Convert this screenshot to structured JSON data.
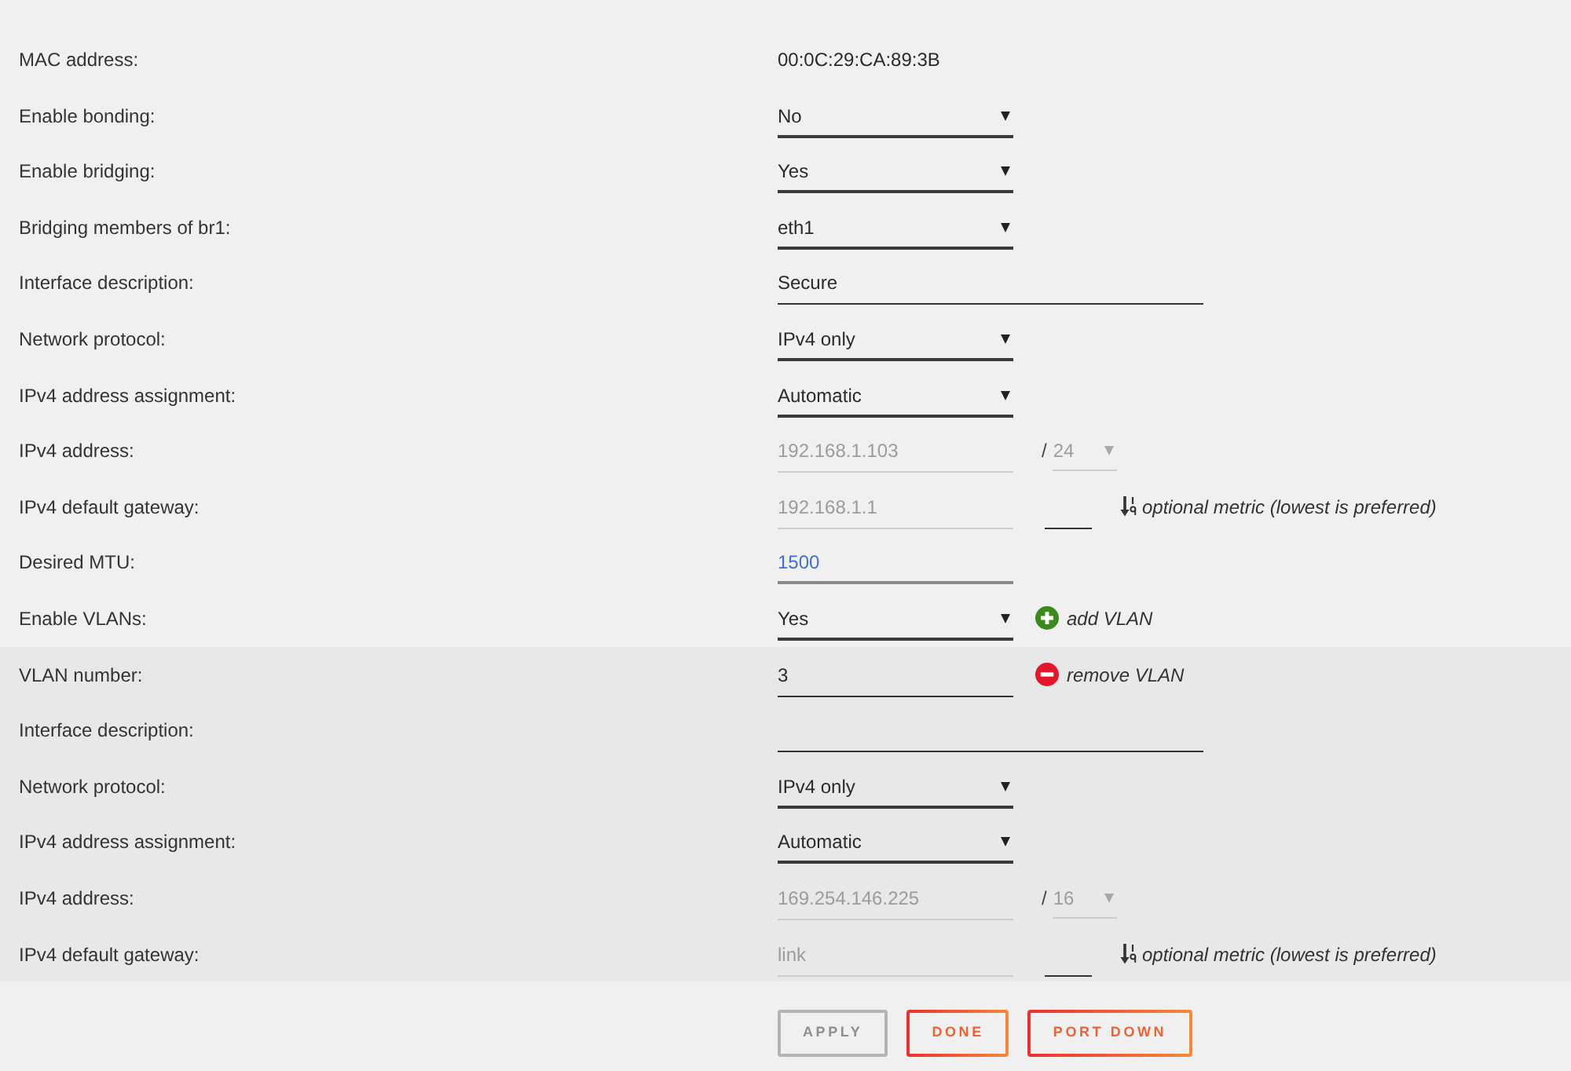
{
  "sections": [
    {
      "kind": "main",
      "rows": [
        {
          "kind": "static",
          "label": "MAC address:",
          "value": "00:0C:29:CA:89:3B",
          "disabled": false,
          "highlighted": false
        },
        {
          "kind": "select",
          "label": "Enable bonding:",
          "value": "No",
          "disabled": false,
          "highlighted": false
        },
        {
          "kind": "select",
          "label": "Enable bridging:",
          "value": "Yes",
          "disabled": false,
          "highlighted": false
        },
        {
          "kind": "select",
          "label": "Bridging members of br1:",
          "value": "eth1",
          "disabled": false,
          "highlighted": false
        },
        {
          "kind": "text",
          "label": "Interface description:",
          "value": "Secure",
          "disabled": false,
          "highlighted": false
        },
        {
          "kind": "select",
          "label": "Network protocol:",
          "value": "IPv4 only",
          "disabled": false,
          "highlighted": false
        },
        {
          "kind": "select",
          "label": "IPv4 address assignment:",
          "value": "Automatic",
          "disabled": false,
          "highlighted": false
        },
        {
          "kind": "address",
          "label": "IPv4 address:",
          "value": "192.168.1.103",
          "disabled": true,
          "highlighted": false,
          "separator": "/",
          "prefix": {
            "value": "24",
            "disabled": true
          }
        },
        {
          "kind": "gateway",
          "label": "IPv4 default gateway:",
          "value": "192.168.1.1",
          "disabled": true,
          "highlighted": false,
          "metric_hint": "optional metric (lowest is preferred)"
        },
        {
          "kind": "input",
          "label": "Desired MTU:",
          "value": "1500",
          "disabled": false,
          "highlighted": true
        },
        {
          "kind": "select",
          "label": "Enable VLANs:",
          "value": "Yes",
          "disabled": false,
          "highlighted": false,
          "action": {
            "kind": "add",
            "label": "add VLAN"
          }
        }
      ]
    },
    {
      "kind": "vlan",
      "rows": [
        {
          "kind": "input",
          "label": "VLAN number:",
          "value": "3",
          "disabled": false,
          "highlighted": false,
          "action": {
            "kind": "remove",
            "label": "remove VLAN"
          }
        },
        {
          "kind": "text",
          "label": "Interface description:",
          "disabled": false,
          "highlighted": false
        },
        {
          "kind": "select",
          "label": "Network protocol:",
          "value": "IPv4 only",
          "disabled": false,
          "highlighted": false
        },
        {
          "kind": "select",
          "label": "IPv4 address assignment:",
          "value": "Automatic",
          "disabled": false,
          "highlighted": false
        },
        {
          "kind": "address",
          "label": "IPv4 address:",
          "value": "169.254.146.225",
          "disabled": true,
          "highlighted": false,
          "separator": "/",
          "prefix": {
            "value": "16",
            "disabled": true
          }
        },
        {
          "kind": "gateway",
          "label": "IPv4 default gateway:",
          "value": "link",
          "disabled": true,
          "highlighted": false,
          "metric_hint": "optional metric (lowest is preferred)"
        }
      ]
    }
  ],
  "buttons": [
    {
      "label": "APPLY",
      "disabled": true
    },
    {
      "label": "DONE",
      "disabled": false
    },
    {
      "label": "PORT DOWN",
      "disabled": false
    }
  ]
}
